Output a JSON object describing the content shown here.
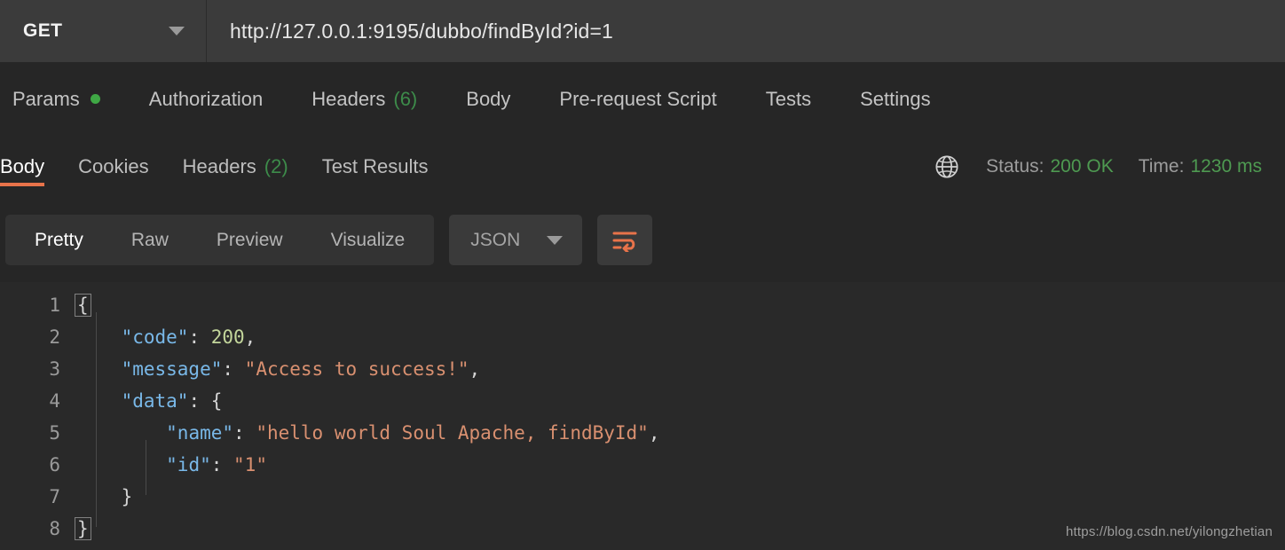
{
  "request_bar": {
    "method": "GET",
    "method_caret_icon": "chevron-down-icon",
    "url": "http://127.0.0.1:9195/dubbo/findById?id=1"
  },
  "request_tabs": [
    {
      "label": "Params",
      "badge": "",
      "dot": true
    },
    {
      "label": "Authorization",
      "badge": "",
      "dot": false
    },
    {
      "label": "Headers",
      "badge": "(6)",
      "dot": false
    },
    {
      "label": "Body",
      "badge": "",
      "dot": false
    },
    {
      "label": "Pre-request Script",
      "badge": "",
      "dot": false
    },
    {
      "label": "Tests",
      "badge": "",
      "dot": false
    },
    {
      "label": "Settings",
      "badge": "",
      "dot": false
    }
  ],
  "response_tabs": [
    {
      "label": "Body",
      "badge": "",
      "active": true
    },
    {
      "label": "Cookies",
      "badge": "",
      "active": false
    },
    {
      "label": "Headers",
      "badge": "(2)",
      "active": false
    },
    {
      "label": "Test Results",
      "badge": "",
      "active": false
    }
  ],
  "response_meta": {
    "globe_icon": "globe-icon",
    "status_label": "Status:",
    "status_value": "200 OK",
    "time_label": "Time:",
    "time_value": "1230 ms"
  },
  "format_toolbar": {
    "tabs": [
      {
        "label": "Pretty",
        "active": true
      },
      {
        "label": "Raw",
        "active": false
      },
      {
        "label": "Preview",
        "active": false
      },
      {
        "label": "Visualize",
        "active": false
      }
    ],
    "language_selected": "JSON",
    "language_caret_icon": "chevron-down-icon",
    "wrap_icon": "wrap-text-icon"
  },
  "response_body": {
    "line_numbers": [
      "1",
      "2",
      "3",
      "4",
      "5",
      "6",
      "7",
      "8"
    ],
    "lines": [
      "{",
      "    \"code\": 200,",
      "    \"message\": \"Access to success!\",",
      "    \"data\": {",
      "        \"name\": \"hello world Soul Apache, findById\",",
      "        \"id\": \"1\"",
      "    }",
      "}"
    ],
    "json": {
      "code": 200,
      "message": "Access to success!",
      "data": {
        "name": "hello world Soul Apache, findById",
        "id": "1"
      }
    }
  },
  "watermark": "https://blog.csdn.net/yilongzhetian",
  "colors": {
    "background": "#262626",
    "panel": "#3b3b3b",
    "accent_orange": "#e8734a",
    "status_green": "#4e9a51",
    "badge_green": "#3d8b4a",
    "dot_green": "#3fa845",
    "code_key": "#79b8e8",
    "code_string": "#d99070",
    "code_number": "#c3d69b"
  }
}
